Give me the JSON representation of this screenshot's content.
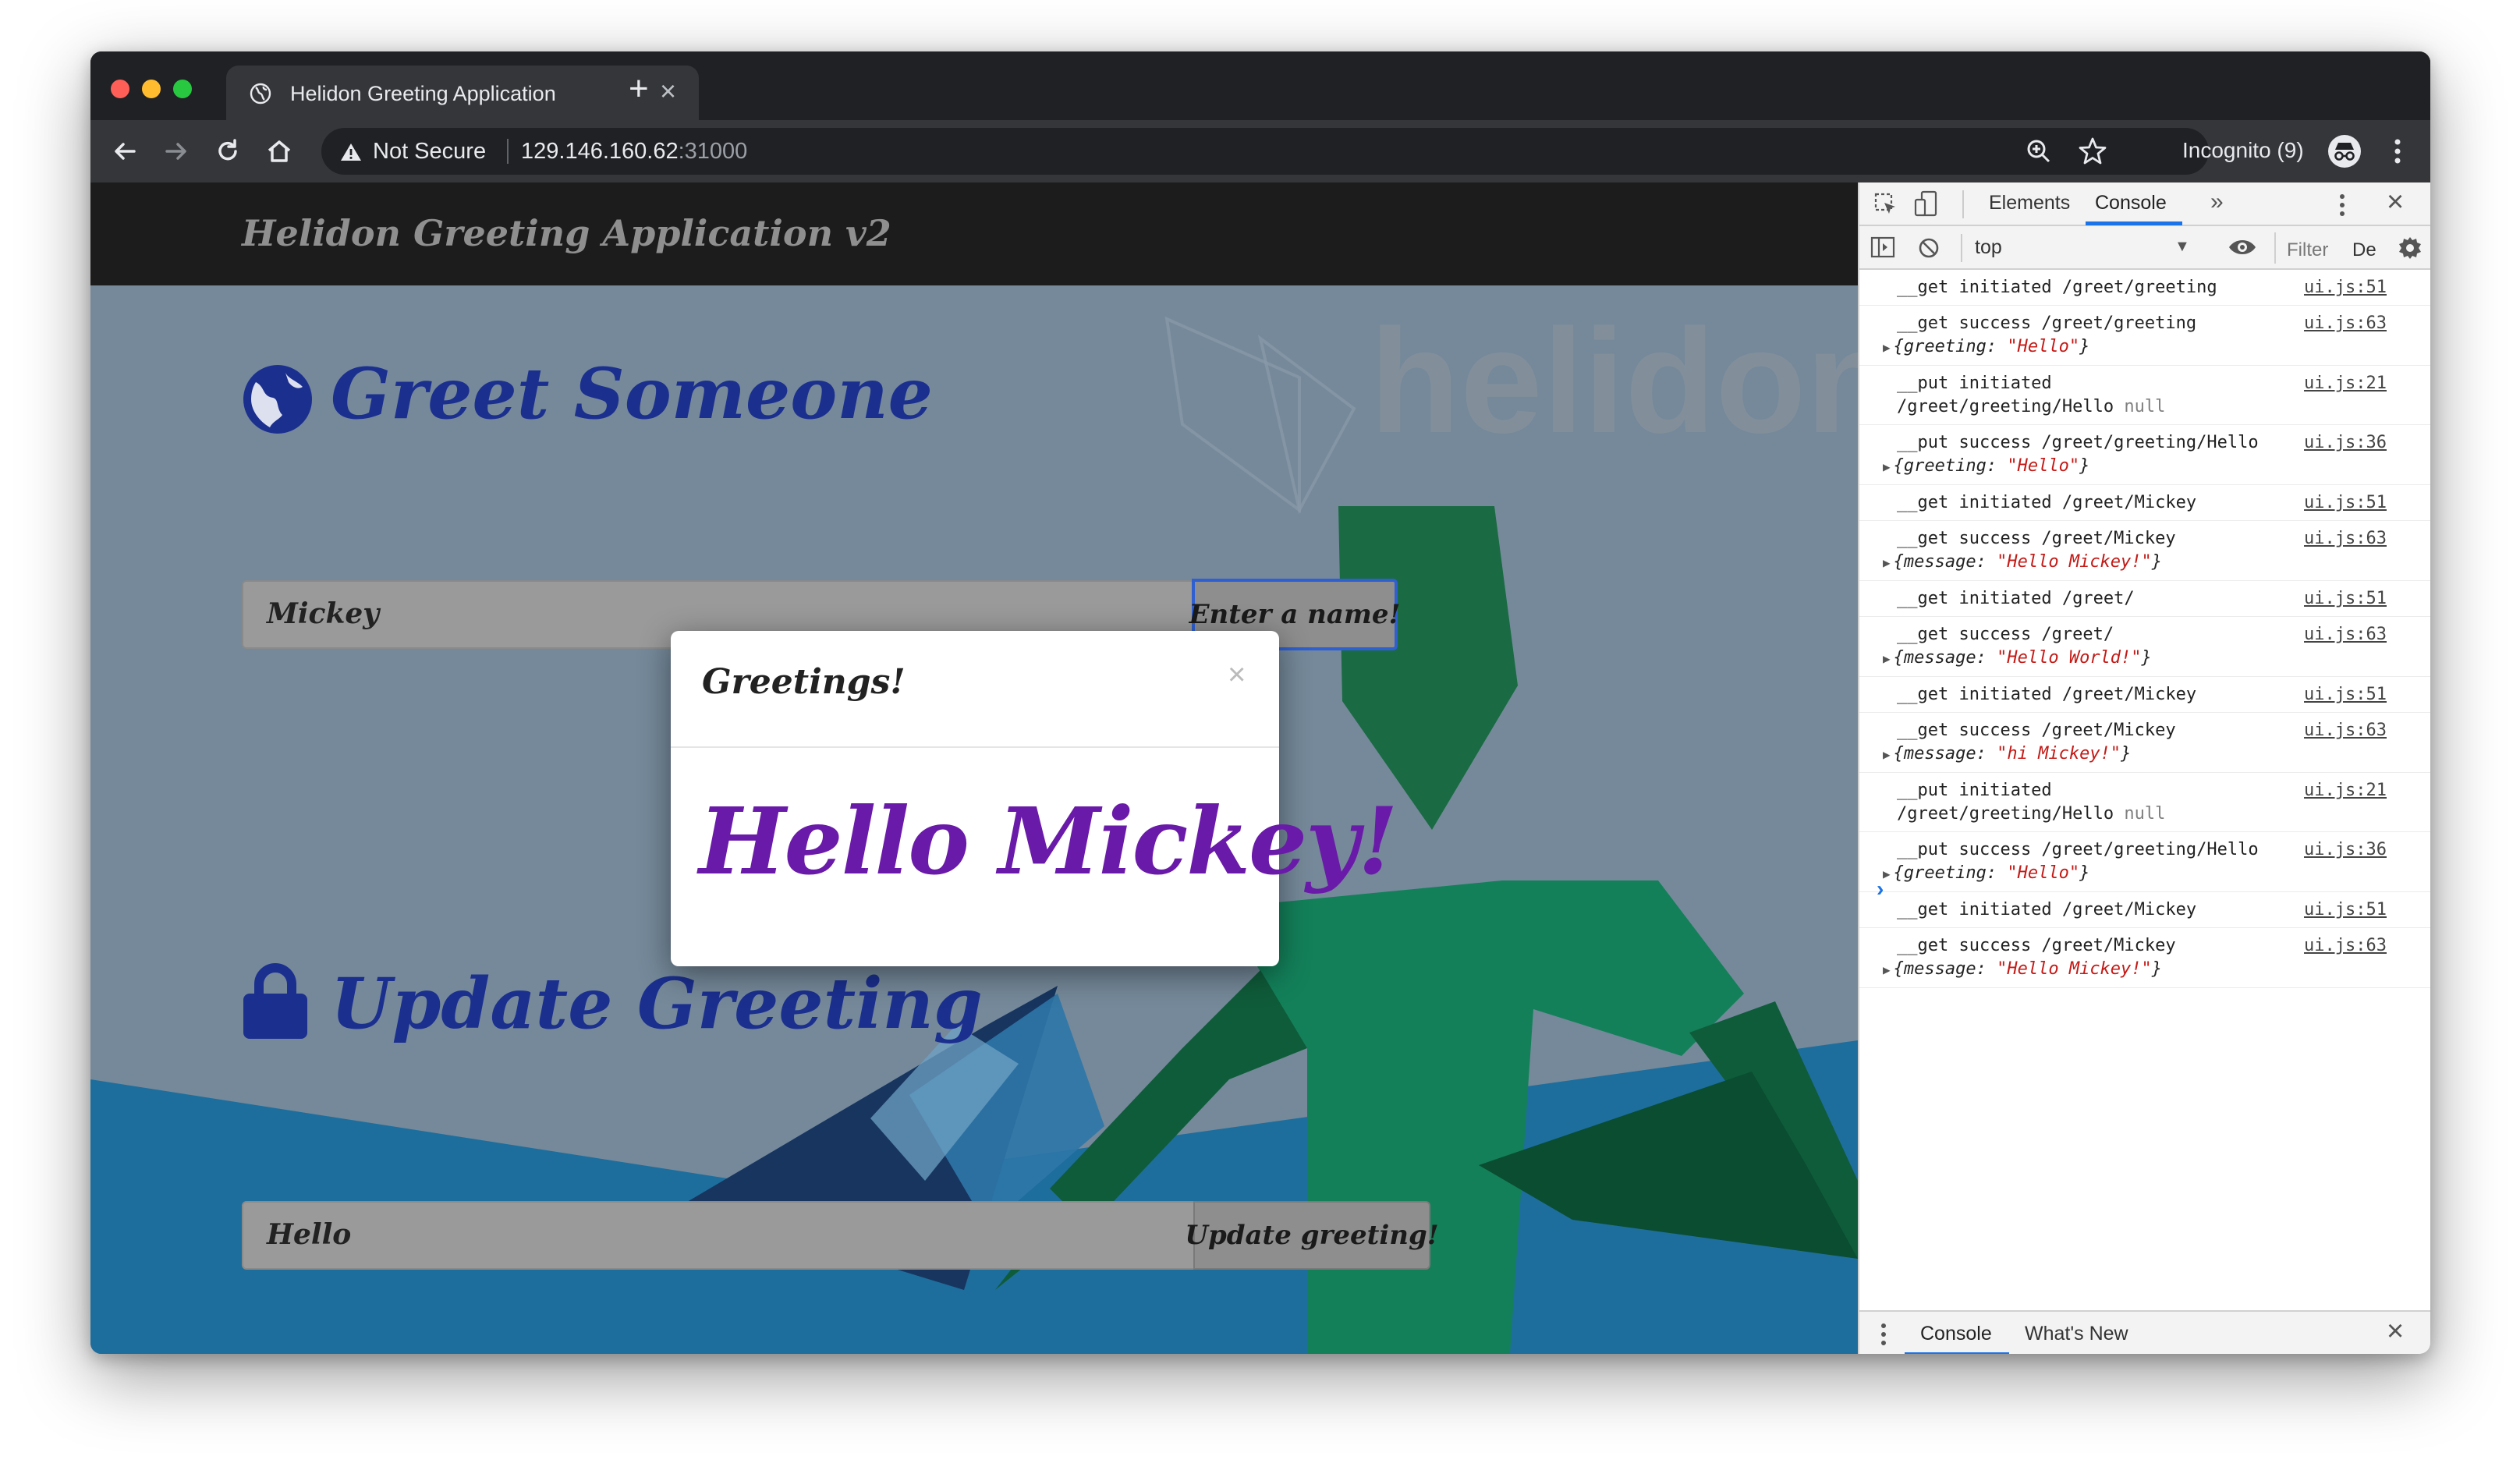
{
  "browser": {
    "tab_title": "Helidon Greeting Application",
    "security_label": "Not Secure",
    "url_host": "129.146.160.62",
    "url_port": ":31000",
    "incognito_label": "Incognito (9)"
  },
  "page": {
    "brand": "Helidon Greeting Application v2",
    "watermark": "helidon.",
    "greet": {
      "heading": "Greet Someone",
      "input_value": "Mickey",
      "button_label": "Enter a name!"
    },
    "update": {
      "heading": "Update Greeting",
      "input_value": "Hello",
      "button_label": "Update greeting!"
    },
    "modal": {
      "title": "Greetings!",
      "close": "×",
      "message": "Hello Mickey!"
    }
  },
  "devtools": {
    "tabs": [
      "Elements",
      "Console"
    ],
    "active_tab": "Console",
    "context": "top",
    "filter_placeholder": "Filter",
    "levels": "De",
    "console_entries": [
      {
        "text": "__get initiated /greet/greeting",
        "src": "ui.js:51"
      },
      {
        "text": "__get success /greet/greeting",
        "src": "ui.js:63",
        "obj_key": "greeting",
        "obj_value": "\"Hello\""
      },
      {
        "text": "__put initiated",
        "text2": "/greet/greeting/Hello",
        "null": "null",
        "src": "ui.js:21"
      },
      {
        "text": "__put success /greet/greeting/Hello",
        "src": "ui.js:36",
        "obj_key": "greeting",
        "obj_value": "\"Hello\""
      },
      {
        "text": "__get initiated /greet/Mickey",
        "src": "ui.js:51"
      },
      {
        "text": "__get success /greet/Mickey",
        "src": "ui.js:63",
        "obj_key": "message",
        "obj_value": "\"Hello Mickey!\""
      },
      {
        "text": "__get initiated /greet/",
        "src": "ui.js:51"
      },
      {
        "text": "__get success /greet/",
        "src": "ui.js:63",
        "obj_key": "message",
        "obj_value": "\"Hello World!\""
      },
      {
        "text": "__get initiated /greet/Mickey",
        "src": "ui.js:51"
      },
      {
        "text": "__get success /greet/Mickey",
        "src": "ui.js:63",
        "obj_key": "message",
        "obj_value": "\"hi Mickey!\""
      },
      {
        "text": "__put initiated",
        "text2": "/greet/greeting/Hello",
        "null": "null",
        "src": "ui.js:21"
      },
      {
        "text": "__put success /greet/greeting/Hello",
        "src": "ui.js:36",
        "obj_key": "greeting",
        "obj_value": "\"Hello\""
      },
      {
        "text": "__get initiated /greet/Mickey",
        "src": "ui.js:51"
      },
      {
        "text": "__get success /greet/Mickey",
        "src": "ui.js:63",
        "obj_key": "message",
        "obj_value": "\"Hello Mickey!\""
      }
    ],
    "prompt": "›",
    "drawer_tabs": [
      "Console",
      "What's New"
    ]
  }
}
